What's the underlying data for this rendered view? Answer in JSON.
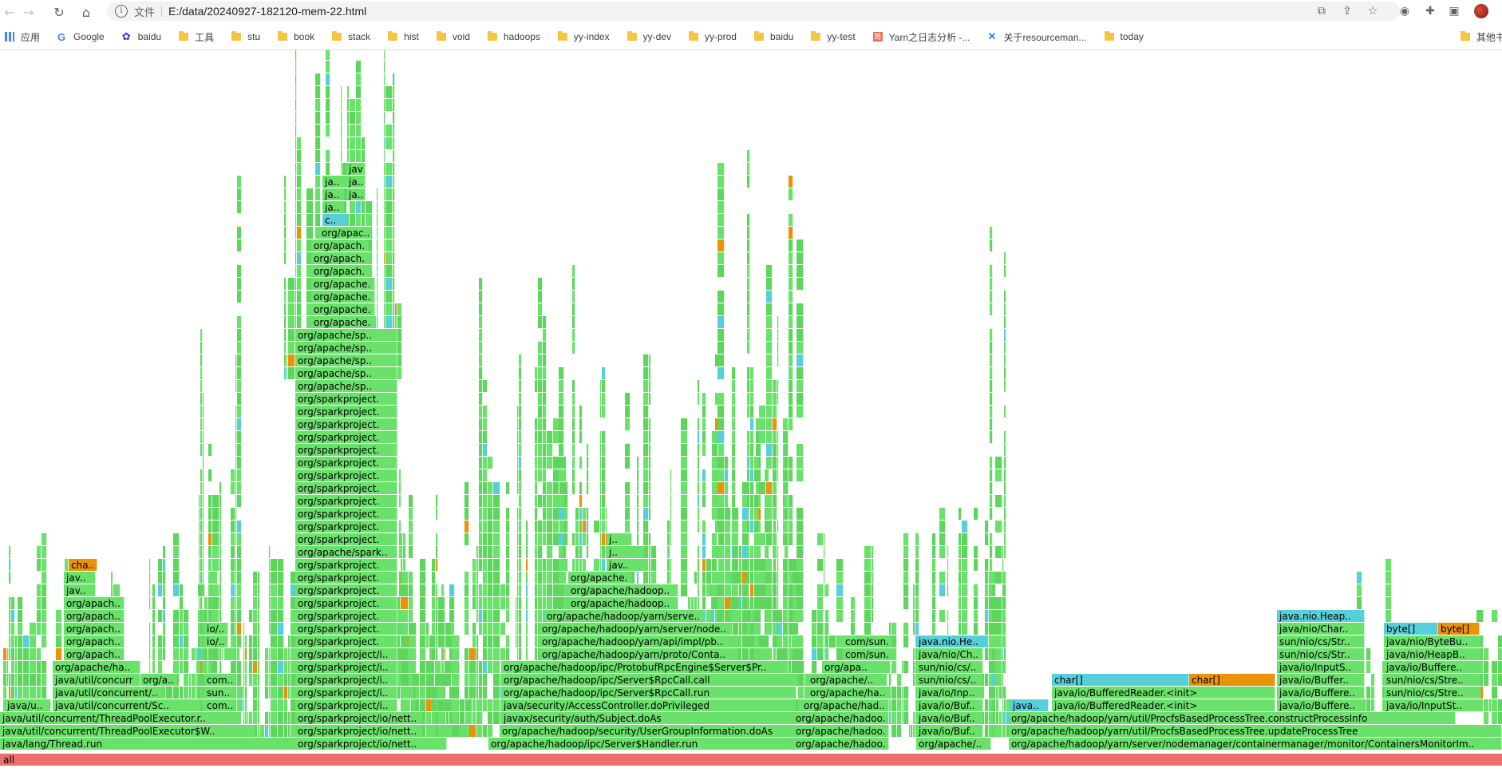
{
  "browser": {
    "scheme_label": "文件",
    "url": "E:/data/20240927-182120-mem-22.html",
    "bookmarks": [
      {
        "label": "应用",
        "icon": "apps-grid-icon"
      },
      {
        "label": "Google",
        "icon": "google-icon"
      },
      {
        "label": "baidu",
        "icon": "baidu-paw-icon"
      },
      {
        "label": "工具",
        "icon": "folder-icon"
      },
      {
        "label": "stu",
        "icon": "folder-icon"
      },
      {
        "label": "book",
        "icon": "folder-icon"
      },
      {
        "label": "stack",
        "icon": "folder-icon"
      },
      {
        "label": "hist",
        "icon": "folder-icon"
      },
      {
        "label": "void",
        "icon": "folder-icon"
      },
      {
        "label": "hadoops",
        "icon": "folder-icon"
      },
      {
        "label": "yy-index",
        "icon": "folder-icon"
      },
      {
        "label": "yy-dev",
        "icon": "folder-icon"
      },
      {
        "label": "yy-prod",
        "icon": "folder-icon"
      },
      {
        "label": "baidu",
        "icon": "folder-icon"
      },
      {
        "label": "yy-test",
        "icon": "folder-icon"
      },
      {
        "label": "Yarn之日志分析 -...",
        "icon": "jianshu-icon"
      },
      {
        "label": "关于resourceman...",
        "icon": "confluence-icon"
      },
      {
        "label": "today",
        "icon": "folder-icon"
      },
      {
        "label": "其他书",
        "icon": "folder-icon"
      }
    ]
  },
  "colors": {
    "green": "#6ae16a",
    "green_alt": "#5ed65e",
    "cyan": "#56cfd9",
    "orange": "#e8930a",
    "root": "#ee6d6d"
  },
  "flame": {
    "root_label": "all",
    "frames": [
      {
        "label": "java/lang/Thread.run",
        "color": "green"
      },
      {
        "label": "java/util/concurrent/ThreadPoolExecutor$W..",
        "color": "green"
      },
      {
        "label": "java/util/concurrent/ThreadPoolExecutor.r..",
        "color": "green"
      },
      {
        "label": "java/u..",
        "color": "green"
      },
      {
        "label": "java/util/concurrent/Sc..",
        "color": "green"
      },
      {
        "label": "java/util/concurrent/..",
        "color": "green"
      },
      {
        "label": "java/util/concurrent/..",
        "color": "green"
      },
      {
        "label": "org/apache/ha..",
        "color": "green"
      },
      {
        "label": "org/apach..",
        "color": "green"
      },
      {
        "label": "org/apach..",
        "color": "green"
      },
      {
        "label": "org/apach..",
        "color": "green"
      },
      {
        "label": "org/apach..",
        "color": "green"
      },
      {
        "label": "org/apach..",
        "color": "green"
      },
      {
        "label": "jav..",
        "color": "green"
      },
      {
        "label": "jav..",
        "color": "green"
      },
      {
        "label": "cha..",
        "color": "orange"
      },
      {
        "label": "org/a..",
        "color": "green"
      },
      {
        "label": "sun..",
        "color": "green"
      },
      {
        "label": "com..",
        "color": "green"
      },
      {
        "label": "com..",
        "color": "green"
      },
      {
        "label": "io/..",
        "color": "green"
      },
      {
        "label": "io/..",
        "color": "green"
      },
      {
        "label": "org/sparkproject/io/nett..",
        "color": "green"
      },
      {
        "label": "org/sparkproject/io/nett..",
        "color": "green"
      },
      {
        "label": "org/sparkproject/io/nett..",
        "color": "green"
      },
      {
        "label": "org/sparkproject/i..",
        "color": "green"
      },
      {
        "label": "org/sparkproject.",
        "color": "green"
      },
      {
        "label": "org/apache/spark..",
        "color": "green"
      },
      {
        "label": "org/apache/sp..",
        "color": "green"
      },
      {
        "label": "org/apache..",
        "color": "green"
      },
      {
        "label": "org/apach..",
        "color": "green"
      },
      {
        "label": "org/apac..",
        "color": "green"
      },
      {
        "label": "org/apache/hadoop/ipc/Server$Handler.run",
        "color": "green"
      },
      {
        "label": "org/apache/hadoop/security/UserGroupInformation.doAs",
        "color": "green"
      },
      {
        "label": "javax/security/auth/Subject.doAs",
        "color": "green"
      },
      {
        "label": "java/security/AccessController.doPrivileged",
        "color": "green"
      },
      {
        "label": "org/apache/hadoop/ipc/Server$RpcCall.run",
        "color": "green"
      },
      {
        "label": "org/apache/hadoop/ipc/Server$RpcCall.call",
        "color": "green"
      },
      {
        "label": "org/apache/hadoop/ipc/ProtobufRpcEngine$Server$Pr..",
        "color": "green"
      },
      {
        "label": "org/apache/hadoop/yarn/proto/Conta..",
        "color": "green"
      },
      {
        "label": "org/apache/hadoop/yarn/api/impl/pb..",
        "color": "green"
      },
      {
        "label": "org/apache/hadoop/yarn/server/node..",
        "color": "green"
      },
      {
        "label": "org/apache/hadoop/yarn/serve..",
        "color": "green"
      },
      {
        "label": "org/apache/hadoop..",
        "color": "green"
      },
      {
        "label": "org/apache/hadoop..",
        "color": "green"
      },
      {
        "label": "org/apache..",
        "color": "green"
      },
      {
        "label": "org/apache/hadoop/yarn/server/nodemanager/containermanager/monitor/ContainersMonitorIm..",
        "color": "green"
      },
      {
        "label": "org/apache/hadoop/yarn/util/ProcfsBasedProcessTree.updateProcessTree",
        "color": "green"
      },
      {
        "label": "org/apache/hadoop/yarn/util/ProcfsBasedProcessTree.constructProcessInfo",
        "color": "green"
      },
      {
        "label": "java/io/BufferedReader.<init>",
        "color": "green"
      },
      {
        "label": "java/io/BufferedReader.<init>",
        "color": "green"
      },
      {
        "label": "char[]",
        "color": "cyan"
      },
      {
        "label": "char[]",
        "color": "orange"
      },
      {
        "label": "java/io/Buffere..",
        "color": "green"
      },
      {
        "label": "java/io/Buffere..",
        "color": "green"
      },
      {
        "label": "java/io/Buffer..",
        "color": "green"
      },
      {
        "label": "java/io/InputS..",
        "color": "green"
      },
      {
        "label": "sun/nio/cs/Str..",
        "color": "green"
      },
      {
        "label": "sun/nio/cs/Str..",
        "color": "green"
      },
      {
        "label": "java/nio/Char..",
        "color": "green"
      },
      {
        "label": "java.nio.Heap..",
        "color": "cyan"
      },
      {
        "label": "java/io/InputSt..",
        "color": "green"
      },
      {
        "label": "sun/nio/cs/Stre..",
        "color": "green"
      },
      {
        "label": "sun/nio/cs/Stre..",
        "color": "green"
      },
      {
        "label": "java/io/Buffere..",
        "color": "green"
      },
      {
        "label": "java/nio/HeapB..",
        "color": "green"
      },
      {
        "label": "java/nio/ByteBu..",
        "color": "green"
      },
      {
        "label": "byte[]",
        "color": "cyan"
      },
      {
        "label": "byte[]",
        "color": "orange"
      },
      {
        "label": "org/apache/..",
        "color": "green"
      },
      {
        "label": "java/io/Buf..",
        "color": "green"
      },
      {
        "label": "java/io/Buf..",
        "color": "green"
      },
      {
        "label": "java/io/Buf..",
        "color": "green"
      },
      {
        "label": "java/io/Inp..",
        "color": "green"
      },
      {
        "label": "sun/nio/cs/..",
        "color": "green"
      },
      {
        "label": "sun/nio/cs/..",
        "color": "green"
      },
      {
        "label": "java/nio/Ch..",
        "color": "green"
      },
      {
        "label": "java.nio.He..",
        "color": "cyan"
      },
      {
        "label": "java..",
        "color": "cyan"
      },
      {
        "label": "org/apache/hadoo..",
        "color": "green"
      },
      {
        "label": "org/apache/hadoo..",
        "color": "green"
      },
      {
        "label": "org/apache/hadoo..",
        "color": "green"
      },
      {
        "label": "org/apache/had..",
        "color": "green"
      },
      {
        "label": "org/apache/ha..",
        "color": "green"
      },
      {
        "label": "org/apache/..",
        "color": "green"
      },
      {
        "label": "org/apa..",
        "color": "green"
      },
      {
        "label": "com/sun..",
        "color": "green"
      },
      {
        "label": "com/sun..",
        "color": "green"
      },
      {
        "label": "c..",
        "color": "green"
      },
      {
        "label": "org/a..",
        "color": "green"
      },
      {
        "label": "org/a..",
        "color": "green"
      },
      {
        "label": "org/a..",
        "color": "green"
      },
      {
        "label": "org/a..",
        "color": "green"
      },
      {
        "label": "or..",
        "color": "green"
      },
      {
        "label": "or..",
        "color": "green"
      },
      {
        "label": "org/apache/hadoop..",
        "color": "green"
      },
      {
        "label": "org/apache/hadoop..",
        "color": "green"
      },
      {
        "label": "org/apache..",
        "color": "green"
      },
      {
        "label": "org/a..",
        "color": "green"
      },
      {
        "label": "jav..",
        "color": "green"
      },
      {
        "label": "j..",
        "color": "green"
      },
      {
        "label": "j..",
        "color": "green"
      },
      {
        "label": "co..",
        "color": "green"
      },
      {
        "label": "or..",
        "color": "green"
      },
      {
        "label": "c..",
        "color": "green"
      },
      {
        "label": "org..",
        "color": "green"
      },
      {
        "label": "org..",
        "color": "green"
      },
      {
        "label": "or..",
        "color": "green"
      },
      {
        "label": "j..",
        "color": "green"
      },
      {
        "label": "ja..",
        "color": "green"
      },
      {
        "label": "c..",
        "color": "cyan"
      },
      {
        "label": "jav..",
        "color": "green"
      },
      {
        "label": "o..",
        "color": "green"
      },
      {
        "label": "s..",
        "color": "green"
      },
      {
        "label": "i..",
        "color": "green"
      },
      {
        "label": "o..",
        "color": "green"
      },
      {
        "label": "or..",
        "color": "green"
      },
      {
        "label": "j..",
        "color": "green"
      }
    ]
  }
}
